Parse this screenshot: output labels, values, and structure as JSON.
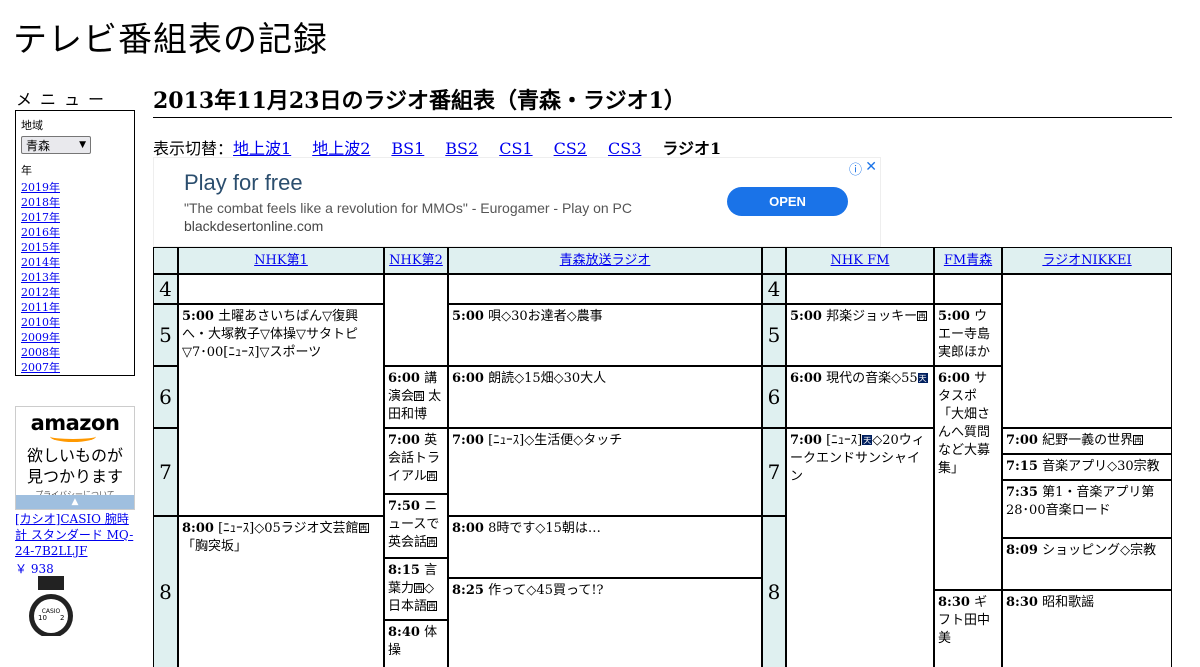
{
  "site_title": "テレビ番組表の記録",
  "menu": {
    "title": "メニュー",
    "region_label": "地域",
    "region_value": "青森",
    "year_label": "年",
    "years": [
      "2019年",
      "2018年",
      "2017年",
      "2016年",
      "2015年",
      "2014年",
      "2013年",
      "2012年",
      "2011年",
      "2010年",
      "2009年",
      "2008年",
      "2007年"
    ]
  },
  "amazon_ad": {
    "logo": "amazon",
    "tagline_1": "欲しいものが",
    "tagline_2": "見つかります",
    "privacy": "プライバシーについて",
    "product": "[カシオ]CASIO 腕時計 スタンダード MQ-24-7B2LLJF",
    "price": "￥ 938"
  },
  "page_heading": "2013年11月23日のラジオ番組表（青森・ラジオ1）",
  "switcher": {
    "label": "表示切替：",
    "links": [
      "地上波1",
      "地上波2",
      "BS1",
      "BS2",
      "CS1",
      "CS2",
      "CS3"
    ],
    "current": "ラジオ1"
  },
  "banner_ad": {
    "title": "Play for free",
    "quote": "\"The combat feels like a revolution for MMOs\" - Eurogamer - Play on PC",
    "domain": "blackdesertonline.com",
    "button": "OPEN",
    "info_icon": "ⓘ",
    "close_icon": "✕"
  },
  "stations": [
    "NHK第1",
    "NHK第2",
    "青森放送ラジオ",
    "NHK FM",
    "FM青森",
    "ラジオNIKKEI"
  ],
  "hours": [
    "4",
    "5",
    "6",
    "7",
    "8"
  ],
  "programs": {
    "nhk1_500": {
      "time": "5:00",
      "title": "土曜あさいちばん▽復興へ・大塚教子▽体操▽サタトピ▽7･00[ﾆｭｰｽ]▽スポーツ"
    },
    "nhk1_800": {
      "time": "8:00",
      "title": "[ﾆｭｰｽ]◇05ラジオ文芸館",
      "title2": "「胸突坂」"
    },
    "nhk2_600": {
      "time": "6:00",
      "title": "講演会",
      "title2": "太田和博"
    },
    "nhk2_700": {
      "time": "7:00",
      "title": "英会話トライアル"
    },
    "nhk2_750": {
      "time": "7:50",
      "title": "ニュースで英会話"
    },
    "nhk2_815": {
      "time": "8:15",
      "title": "言葉力",
      "title2": "◇日本語"
    },
    "nhk2_840": {
      "time": "8:40",
      "title": "体操"
    },
    "abs_500": {
      "time": "5:00",
      "title": "唄◇30お達者◇農事"
    },
    "abs_600": {
      "time": "6:00",
      "title": "朗読◇15畑◇30大人"
    },
    "abs_700": {
      "time": "7:00",
      "title": "[ﾆｭｰｽ]◇生活便◇タッチ"
    },
    "abs_800": {
      "time": "8:00",
      "title": "8時です◇15朝は…"
    },
    "abs_825": {
      "time": "8:25",
      "title": "作って◇45買って!?"
    },
    "fm_500": {
      "time": "5:00",
      "title": "邦楽ジョッキー"
    },
    "fm_600": {
      "time": "6:00",
      "title": "現代の音楽◇55"
    },
    "fm_700": {
      "time": "7:00",
      "title": "[ﾆｭｰｽ]",
      "title2": "◇20ウィークエンドサンシャイン"
    },
    "fma_500": {
      "time": "5:00",
      "title": "ウエー寺島実郎ほか"
    },
    "fma_600": {
      "time": "6:00",
      "title": "サタスポ「大畑さんへ質問など大募集」"
    },
    "fma_830": {
      "time": "8:30",
      "title": "ギフト田中美"
    },
    "nikkei_700": {
      "time": "7:00",
      "title": "紀野一義の世界"
    },
    "nikkei_715": {
      "time": "7:15",
      "title": "音楽アプリ◇30宗教"
    },
    "nikkei_735": {
      "time": "7:35",
      "title": "第1・音楽アプリ第28･00音楽ロード"
    },
    "nikkei_809": {
      "time": "8:09",
      "title": "ショッピング◇宗教"
    },
    "nikkei_830": {
      "time": "8:30",
      "title": "昭和歌謡"
    }
  },
  "icons": {
    "rebroadcast": "再",
    "weather": "天"
  }
}
